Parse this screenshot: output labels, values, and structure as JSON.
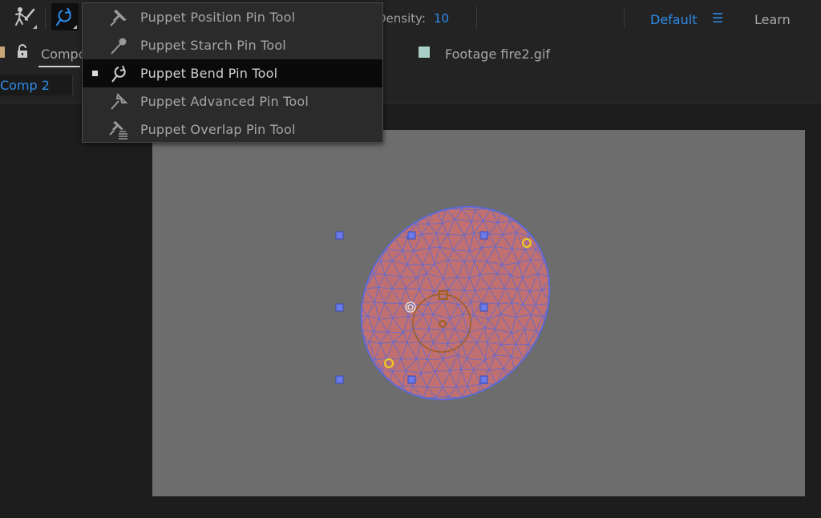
{
  "toolbar": {
    "density_label": "Density:",
    "density_value": "10",
    "workspace": "Default",
    "workspace_menu_glyph": "☰",
    "learn": "Learn",
    "tools": [
      {
        "name": "puppet-tool",
        "icon": "puppet-figure-icon"
      },
      {
        "name": "puppet-bend-pin-tool",
        "icon": "bend-pin-icon",
        "active": true
      }
    ]
  },
  "menu": {
    "items": [
      {
        "label": "Puppet Position Pin Tool",
        "icon": "pushpin-icon",
        "selected": false
      },
      {
        "label": "Puppet Starch Pin Tool",
        "icon": "starch-pin-icon",
        "selected": false
      },
      {
        "label": "Puppet Bend Pin Tool",
        "icon": "bend-pin-icon",
        "selected": true
      },
      {
        "label": "Puppet Advanced Pin Tool",
        "icon": "advanced-pin-icon",
        "selected": false
      },
      {
        "label": "Puppet Overlap Pin Tool",
        "icon": "overlap-pin-icon",
        "selected": false
      }
    ]
  },
  "panels": {
    "composition_tab": "Compo",
    "footage_tab": "Footage  fire2.gif",
    "comp_breadcrumb": "Comp 2"
  },
  "colors": {
    "accent": "#2d8ceb",
    "shape_fill": "#c07070",
    "mesh_line": "#5a6ad8",
    "handle": "#6a7ae8",
    "pin_yellow": "#f0d020",
    "bend_pin": "#a06020",
    "canvas": "#6d6d6d"
  }
}
